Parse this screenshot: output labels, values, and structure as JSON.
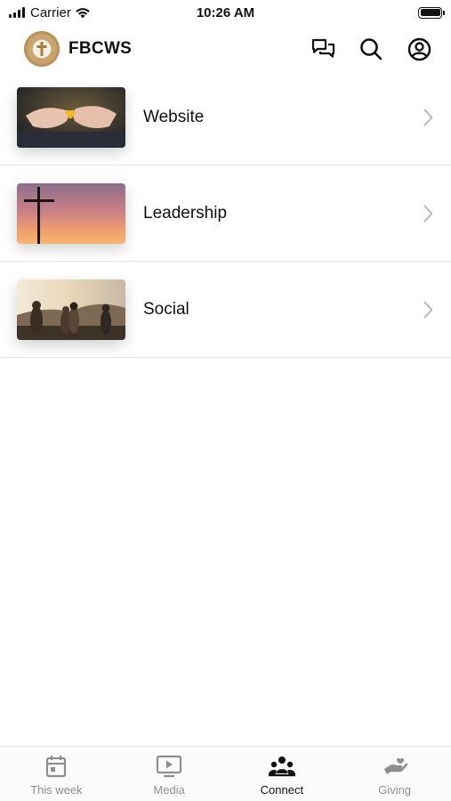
{
  "status_bar": {
    "carrier": "Carrier",
    "time": "10:26 AM"
  },
  "header": {
    "title": "FBCWS",
    "actions": [
      {
        "name": "messages-icon"
      },
      {
        "name": "search-icon"
      },
      {
        "name": "account-icon"
      }
    ]
  },
  "list": {
    "items": [
      {
        "label": "Website",
        "thumbnail": "hands-flower-image"
      },
      {
        "label": "Leadership",
        "thumbnail": "cross-sunset-image"
      },
      {
        "label": "Social",
        "thumbnail": "friends-sunset-image"
      }
    ]
  },
  "tab_bar": {
    "tabs": [
      {
        "label": "This week",
        "icon": "calendar-icon",
        "active": false
      },
      {
        "label": "Media",
        "icon": "play-icon",
        "active": false
      },
      {
        "label": "Connect",
        "icon": "people-icon",
        "active": true
      },
      {
        "label": "Giving",
        "icon": "giving-hand-icon",
        "active": false
      }
    ],
    "active_color": "#111111",
    "inactive_color": "#8e8e8e"
  }
}
